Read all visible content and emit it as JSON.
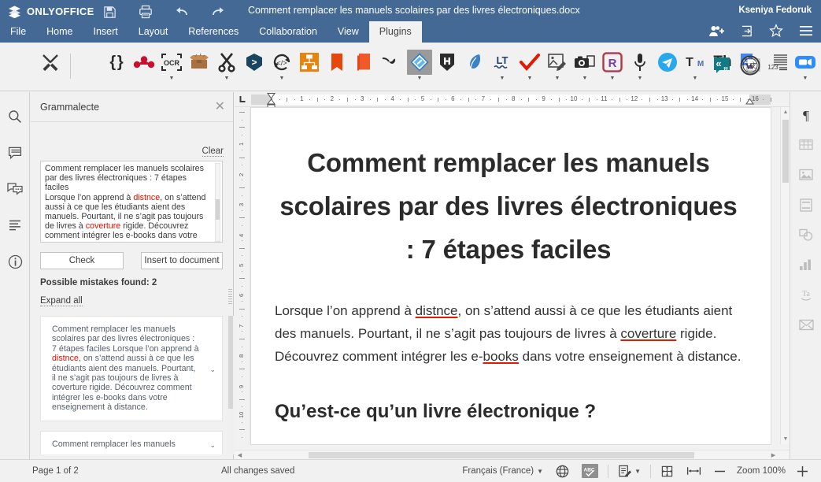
{
  "header": {
    "brand": "ONLYOFFICE",
    "brand_logo_icon": "layers-logo-icon",
    "doc_title": "Comment remplacer les manuels scolaires par des livres électroniques.docx",
    "user_name": "Kseniya Fedoruk",
    "quick_icons": [
      {
        "name": "save-icon",
        "label": "Save"
      },
      {
        "name": "print-icon",
        "label": "Print"
      },
      {
        "name": "undo-icon",
        "label": "Undo"
      },
      {
        "name": "redo-icon",
        "label": "Redo"
      }
    ],
    "tabs": [
      {
        "label": "File",
        "active": false
      },
      {
        "label": "Home",
        "active": false
      },
      {
        "label": "Insert",
        "active": false
      },
      {
        "label": "Layout",
        "active": false
      },
      {
        "label": "References",
        "active": false
      },
      {
        "label": "Collaboration",
        "active": false
      },
      {
        "label": "View",
        "active": false
      },
      {
        "label": "Plugins",
        "active": true
      }
    ],
    "right_icons": [
      {
        "name": "manage-access-rights-icon"
      },
      {
        "name": "open-file-location-icon"
      },
      {
        "name": "favorite-star-icon"
      },
      {
        "name": "advanced-settings-menu-icon"
      }
    ]
  },
  "plugins_toolbar": {
    "settings_icon": "plugin-settings-wrench-icon",
    "items": [
      {
        "name": "plugin-macros-icon",
        "glyph": "{ }",
        "color": "#3b3b3b",
        "caret": false,
        "selected": false
      },
      {
        "name": "plugin-mendeley-icon",
        "glyph": "mendeley",
        "color": "#c8102e",
        "caret": false,
        "selected": false
      },
      {
        "name": "plugin-ocr-icon",
        "glyph": "OCR",
        "color": "#3b3b3b",
        "caret": true,
        "selected": false
      },
      {
        "name": "plugin-unsplash-box-icon",
        "glyph": "box",
        "color": "#8b5e3c",
        "caret": false,
        "selected": false
      },
      {
        "name": "plugin-clipart-scissors-icon",
        "glyph": "scissors",
        "color": "#2b2b2b",
        "caret": true,
        "selected": false
      },
      {
        "name": "plugin-zotero-icon",
        "glyph": "zotero",
        "color": "#19455e",
        "caret": false,
        "selected": false
      },
      {
        "name": "plugin-doc-translator-icon",
        "glyph": "translate-cycle",
        "color": "#2b2b2b",
        "caret": true,
        "selected": false
      },
      {
        "name": "plugin-draw-io-icon",
        "glyph": "drawio",
        "color": "#e8830c",
        "caret": false,
        "selected": false
      },
      {
        "name": "plugin-wordpress-red-icon",
        "glyph": "book-red",
        "color": "#e8470c",
        "caret": false,
        "selected": false
      },
      {
        "name": "plugin-readability-icon",
        "glyph": "book-orange",
        "color": "#f05a28",
        "caret": false,
        "selected": false
      },
      {
        "name": "plugin-pipe-icon",
        "glyph": "pipe",
        "color": "#2b2b2b",
        "caret": false,
        "selected": false
      },
      {
        "name": "plugin-grammalecte-icon",
        "glyph": "grammalecte",
        "color": "#3d9ad1",
        "caret": true,
        "selected": true
      },
      {
        "name": "plugin-highlight-code-icon",
        "glyph": "H-shield",
        "color": "#2b2b2b",
        "caret": false,
        "selected": false
      },
      {
        "name": "plugin-thesaurus-blue-icon",
        "glyph": "feather",
        "color": "#3b82c4",
        "caret": false,
        "selected": false
      },
      {
        "name": "plugin-languagetool-icon",
        "glyph": "LT",
        "color": "#23406e",
        "caret": true,
        "selected": false
      },
      {
        "name": "plugin-spellcheck-check-icon",
        "glyph": "red-check",
        "color": "#e01b00",
        "caret": true,
        "selected": false
      },
      {
        "name": "plugin-photo-editor-icon",
        "glyph": "photo-edit",
        "color": "#4a4a4a",
        "caret": true,
        "selected": false
      },
      {
        "name": "plugin-camera-icon",
        "glyph": "camera",
        "color": "#2b2b2b",
        "caret": true,
        "selected": false
      },
      {
        "name": "plugin-rainbow-r-icon",
        "glyph": "R",
        "color": "#7b3fa0",
        "caret": true,
        "selected": false
      },
      {
        "name": "plugin-speech-microphone-icon",
        "glyph": "microphone",
        "color": "#2b2b2b",
        "caret": true,
        "selected": false
      },
      {
        "name": "plugin-telegram-icon",
        "glyph": "telegram",
        "color": "#29a9eb",
        "caret": false,
        "selected": false
      },
      {
        "name": "plugin-translator-tm-icon",
        "glyph": "TM",
        "color": "#2b2b2b",
        "caret": true,
        "selected": false
      },
      {
        "name": "plugin-thesaurus-th-icon",
        "glyph": "Th",
        "color": "#2b2b2b",
        "caret": false,
        "selected": false
      },
      {
        "name": "plugin-google-translate-icon",
        "glyph": "gtranslate",
        "color": "#4285f4",
        "caret": false,
        "selected": false
      },
      {
        "name": "plugin-quotes-icon",
        "glyph": "quotes",
        "color": "#107b84",
        "caret": false,
        "selected": false
      },
      {
        "name": "plugin-wordpress-icon",
        "glyph": "wordpress",
        "color": "#3b3b3b",
        "caret": false,
        "selected": false
      },
      {
        "name": "plugin-count-lines-icon",
        "glyph": "123-lines",
        "color": "#3b3b3b",
        "caret": false,
        "selected": false
      },
      {
        "name": "plugin-zoom-icon",
        "glyph": "zoom-cam",
        "color": "#2d8cff",
        "caret": true,
        "selected": false
      }
    ]
  },
  "left_rail": [
    {
      "name": "sidebar-search-icon",
      "label": "Search"
    },
    {
      "name": "sidebar-comments-icon",
      "label": "Comments"
    },
    {
      "name": "sidebar-chat-icon",
      "label": "Chat"
    },
    {
      "name": "sidebar-headings-icon",
      "label": "Headings"
    },
    {
      "name": "sidebar-about-icon",
      "label": "About"
    }
  ],
  "right_rail": [
    {
      "name": "paragraph-settings-icon",
      "active": true
    },
    {
      "name": "table-settings-icon",
      "active": false
    },
    {
      "name": "image-settings-icon",
      "active": false
    },
    {
      "name": "header-footer-settings-icon",
      "active": false
    },
    {
      "name": "shape-settings-icon",
      "active": false
    },
    {
      "name": "chart-settings-icon",
      "active": false
    },
    {
      "name": "text-art-settings-icon",
      "active": false
    },
    {
      "name": "mail-merge-settings-icon",
      "active": false
    }
  ],
  "grammalecte": {
    "title": "Grammalecte",
    "close_icon": "close-icon",
    "clear_label": "Clear",
    "textarea_value": "Comment remplacer les manuels scolaires par des livres électroniques : 7 étapes faciles\nLorsque l’on apprend à distnce, on s’attend aussi à ce que les étudiants aient des manuels. Pourtant, il ne s’agit pas toujours de livres à coverture rigide. Découvrez comment intégrer les e-books dans votre",
    "textarea_segments": [
      {
        "text": "Comment remplacer les manuels scolaires par des livres électroniques : 7 étapes faciles",
        "error": false
      },
      {
        "text": "\n",
        "error": false
      },
      {
        "text": "Lorsque l’on apprend à ",
        "error": false
      },
      {
        "text": "distnce",
        "error": true
      },
      {
        "text": ", on s’attend aussi à ce que les étudiants aient des manuels. Pourtant, il ne s’agit pas toujours de livres à ",
        "error": false
      },
      {
        "text": "coverture",
        "error": true
      },
      {
        "text": " rigide. Découvrez comment intégrer les e-books dans votre",
        "error": false
      }
    ],
    "check_button": "Check",
    "insert_button": "Insert to document",
    "mistakes_label": "Possible mistakes found: 2",
    "expand_all_label": "Expand all",
    "cards": [
      {
        "segments": [
          {
            "text": "Comment remplacer les manuels scolaires par des livres électroniques : 7 étapes faciles Lorsque l’on apprend à ",
            "error": false
          },
          {
            "text": "distnce",
            "error": true
          },
          {
            "text": ", on s’attend aussi à ce que les étudiants aient des manuels. Pourtant, il ne s’agit pas toujours de livres à coverture rigide. Découvrez comment intégrer les e-books dans votre enseignement à distance.",
            "error": false
          }
        ],
        "caret_icon": "chevron-down-icon"
      },
      {
        "segments": [
          {
            "text": "Comment remplacer les manuels",
            "error": false
          }
        ],
        "caret_icon": "chevron-down-icon"
      }
    ]
  },
  "ruler": {
    "corner_icon": "tab-stop-left-icon",
    "numbers": [
      1,
      2,
      3,
      4,
      5,
      6,
      7,
      8,
      9,
      10,
      11,
      12,
      13,
      14,
      15,
      16
    ],
    "vertical_numbers": [
      1,
      2,
      3,
      4,
      5,
      6,
      7,
      8,
      9,
      10
    ],
    "first_line_indent_icon": "first-line-indent-marker",
    "left_indent_icon": "left-indent-marker",
    "right_indent_icon": "right-indent-marker"
  },
  "document": {
    "h1": "Comment remplacer les manuels scolaires par des livres électroniques : 7 étapes faciles",
    "paragraph_segments": [
      {
        "text": "Lorsque l’on apprend à ",
        "error": false
      },
      {
        "text": "distnce",
        "error": true
      },
      {
        "text": ", on s’attend aussi à ce que les étudiants aient des manuels. Pourtant, il ne s’agit pas toujours de livres à ",
        "error": false
      },
      {
        "text": "coverture",
        "error": true
      },
      {
        "text": " rigide. Découvrez comment intégrer les e-",
        "error": false
      },
      {
        "text": "books",
        "error": true
      },
      {
        "text": " dans votre enseignement à distance.",
        "error": false
      }
    ],
    "h2": "Qu’est-ce qu’un livre électronique ?"
  },
  "statusbar": {
    "page_info": "Page 1 of 2",
    "save_status": "All changes saved",
    "language": "Français (France)",
    "language_caret_icon": "chevron-down-icon",
    "globe_icon": "set-document-language-icon",
    "spellcheck_icon": "spell-checking-icon",
    "track_changes_icon": "track-changes-icon",
    "track_changes_caret_icon": "chevron-down-icon",
    "fit_page_icon": "fit-to-page-icon",
    "fit_width_icon": "fit-to-width-icon",
    "zoom_out_icon": "zoom-out-icon",
    "zoom_label": "Zoom 100%",
    "zoom_in_icon": "zoom-in-icon"
  },
  "colors": {
    "header_blue": "#446995",
    "chrome_grey": "#f1f1f1",
    "error_red": "#dd1100",
    "selected_plugin_bg": "#9a9a9a"
  }
}
